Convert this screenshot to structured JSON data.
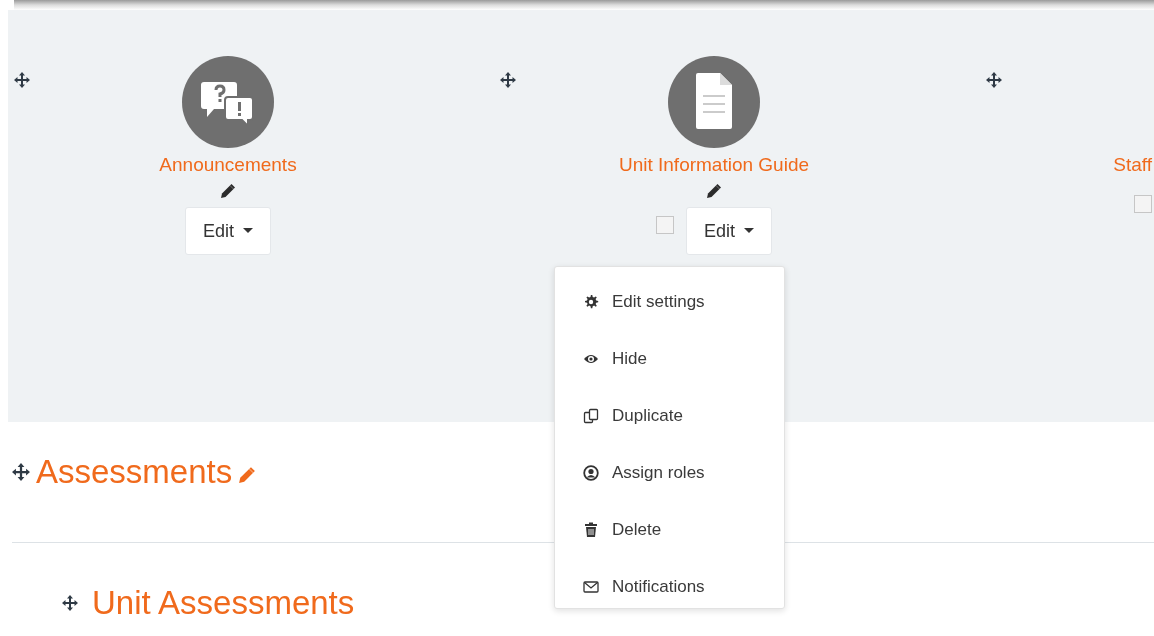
{
  "activities": [
    {
      "kind": "forum",
      "title": "Announcements",
      "editable": true,
      "edit_button": "Edit"
    },
    {
      "kind": "page",
      "title": "Unit Information Guide",
      "editable": true,
      "checked": false,
      "edit_button": "Edit"
    },
    {
      "title": "Staff",
      "checked": false
    }
  ],
  "menu": {
    "items": [
      {
        "kind": "settings",
        "label": "Edit settings"
      },
      {
        "kind": "hide",
        "label": "Hide"
      },
      {
        "kind": "duplicate",
        "label": "Duplicate"
      },
      {
        "kind": "roles",
        "label": "Assign roles"
      },
      {
        "kind": "delete",
        "label": "Delete"
      },
      {
        "kind": "notifications",
        "label": "Notifications"
      }
    ]
  },
  "sections": [
    {
      "kind": "section",
      "title": "Assessments",
      "editable": true
    },
    {
      "kind": "subsection",
      "title": "Unit Assessments"
    }
  ]
}
